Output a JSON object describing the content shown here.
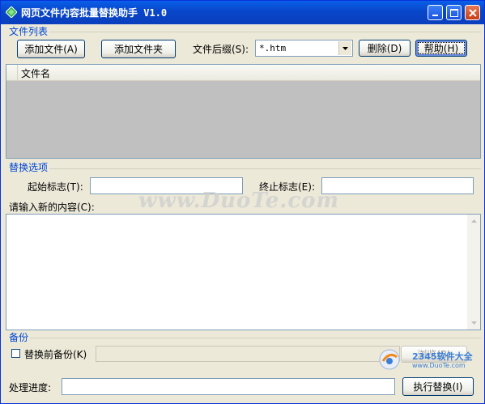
{
  "window": {
    "title": "网页文件内容批量替换助手  V1.0"
  },
  "file_list_group": {
    "label": "文件列表",
    "add_file": "添加文件(A)",
    "add_folder": "添加文件夹",
    "suffix_label": "文件后缀(S):",
    "suffix_value": "*.htm",
    "delete": "删除(D)",
    "help": "帮助(H)",
    "column_filename": "文件名"
  },
  "replace_group": {
    "label": "替换选项",
    "start_label": "起始标志(T):",
    "end_label": "终止标志(E):",
    "new_content_label": "请输入新的内容(C):",
    "start_value": "",
    "end_value": "",
    "new_content_value": ""
  },
  "backup_group": {
    "label": "备份",
    "checkbox_label": "替换前备份(K)",
    "checked": false,
    "path_value": "",
    "browse": "浏览(B)"
  },
  "footer": {
    "progress_label": "处理进度:",
    "progress_value": 0,
    "execute": "执行替换(I)"
  },
  "watermark": "www.DuoTe.com",
  "logo": {
    "text": "2345软件大全",
    "sub": "www.DuoTe.com"
  },
  "colors": {
    "title_bar": "#0a4fd6",
    "group_label": "#0046d5",
    "list_bg": "#c0c0c0",
    "window_bg": "#ece9d8"
  },
  "icons": {
    "app": "diamond-icon",
    "minimize": "minimize-icon",
    "maximize": "maximize-icon",
    "close": "close-icon"
  }
}
